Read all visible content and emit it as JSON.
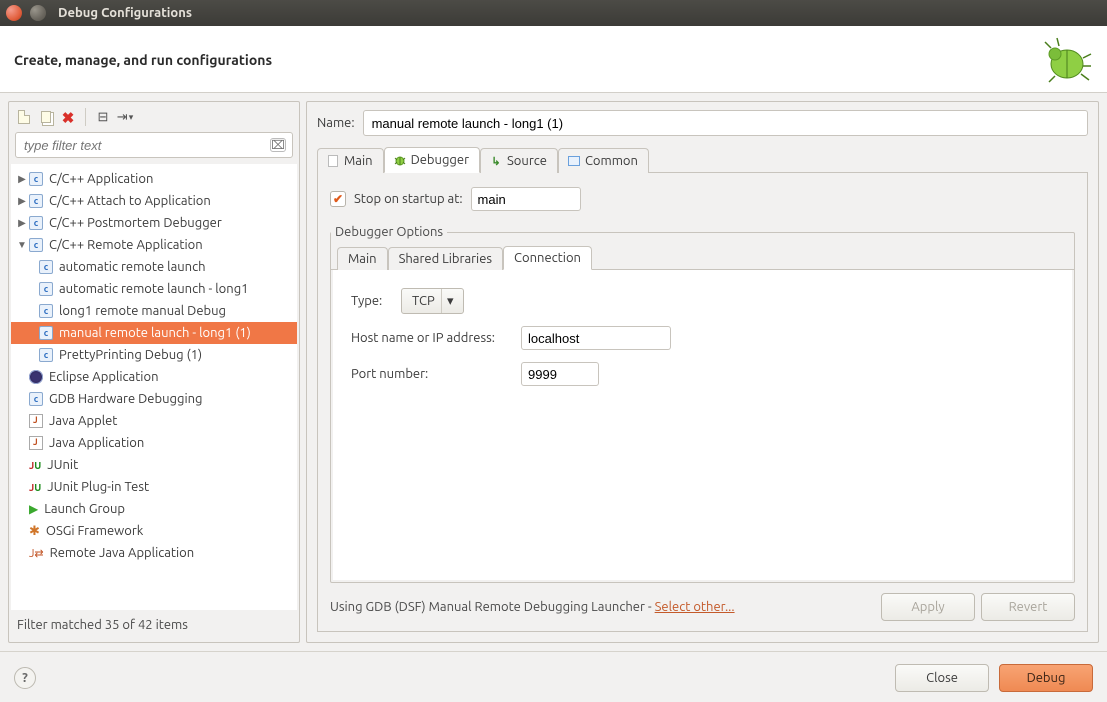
{
  "window": {
    "title": "Debug Configurations"
  },
  "header": {
    "subtitle": "Create, manage, and run configurations"
  },
  "filter": {
    "placeholder": "type filter text"
  },
  "tree": [
    {
      "label": "C/C++ Application",
      "expander": "▶",
      "icon": "cfg",
      "level": 0
    },
    {
      "label": "C/C++ Attach to Application",
      "expander": "▶",
      "icon": "cfg",
      "level": 0
    },
    {
      "label": "C/C++ Postmortem Debugger",
      "expander": "▶",
      "icon": "cfg",
      "level": 0
    },
    {
      "label": "C/C++ Remote Application",
      "expander": "▼",
      "icon": "cfg",
      "level": 0
    },
    {
      "label": "automatic remote launch",
      "expander": "",
      "icon": "cfg",
      "level": 1
    },
    {
      "label": "automatic remote launch - long1",
      "expander": "",
      "icon": "cfg",
      "level": 1
    },
    {
      "label": "long1 remote manual Debug",
      "expander": "",
      "icon": "cfg",
      "level": 1
    },
    {
      "label": "manual remote launch - long1 (1)",
      "expander": "",
      "icon": "cfg",
      "level": 1,
      "selected": true
    },
    {
      "label": "PrettyPrinting Debug (1)",
      "expander": "",
      "icon": "cfg",
      "level": 1
    },
    {
      "label": "Eclipse Application",
      "expander": "",
      "icon": "eclipse",
      "level": 0
    },
    {
      "label": "GDB Hardware Debugging",
      "expander": "",
      "icon": "cfg",
      "level": 0
    },
    {
      "label": "Java Applet",
      "expander": "",
      "icon": "java",
      "level": 0
    },
    {
      "label": "Java Application",
      "expander": "",
      "icon": "java",
      "level": 0
    },
    {
      "label": "JUnit",
      "expander": "",
      "icon": "junit",
      "level": 0
    },
    {
      "label": "JUnit Plug-in Test",
      "expander": "",
      "icon": "junit",
      "level": 0
    },
    {
      "label": "Launch Group",
      "expander": "",
      "icon": "launch",
      "level": 0
    },
    {
      "label": "OSGi Framework",
      "expander": "",
      "icon": "osgi",
      "level": 0
    },
    {
      "label": "Remote Java Application",
      "expander": "",
      "icon": "remote",
      "level": 0
    }
  ],
  "filter_status": "Filter matched 35 of 42 items",
  "name": {
    "label": "Name:",
    "value": "manual remote launch - long1 (1)"
  },
  "tabs": {
    "main": "Main",
    "debugger": "Debugger",
    "source": "Source",
    "common": "Common"
  },
  "stop_on_startup": {
    "label": "Stop on startup at:",
    "value": "main"
  },
  "dbg_options_legend": "Debugger Options",
  "subtabs": {
    "main": "Main",
    "shared": "Shared Libraries",
    "connection": "Connection"
  },
  "connection": {
    "type_label": "Type:",
    "type_value": "TCP",
    "host_label": "Host name or IP address:",
    "host_value": "localhost",
    "port_label": "Port number:",
    "port_value": "9999"
  },
  "launcher": {
    "prefix": "Using GDB (DSF) Manual Remote Debugging Launcher - ",
    "link": "Select other..."
  },
  "buttons": {
    "apply": "Apply",
    "revert": "Revert",
    "close": "Close",
    "debug": "Debug"
  }
}
